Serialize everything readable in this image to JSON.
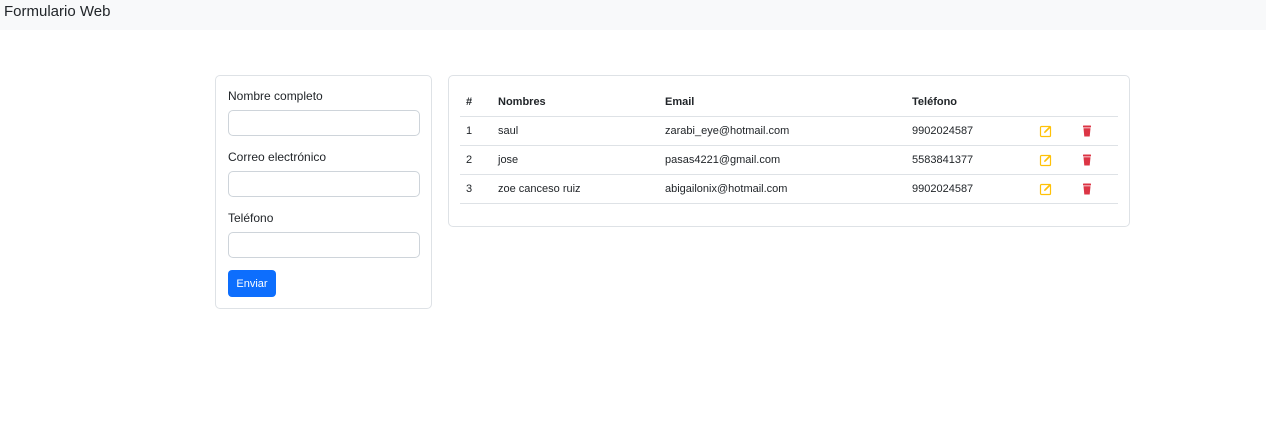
{
  "app": {
    "brand": "Formulario Web"
  },
  "form": {
    "fields": [
      {
        "label": "Nombre completo",
        "value": "",
        "placeholder": ""
      },
      {
        "label": "Correo electrónico",
        "value": "",
        "placeholder": ""
      },
      {
        "label": "Teléfono",
        "value": "",
        "placeholder": ""
      }
    ],
    "submit_label": "Enviar"
  },
  "table": {
    "headers": [
      "#",
      "Nombres",
      "Email",
      "Teléfono"
    ],
    "rows": [
      {
        "num": "1",
        "name": "saul",
        "email": "zarabi_eye@hotmail.com",
        "phone": "9902024587"
      },
      {
        "num": "2",
        "name": "jose",
        "email": "pasas4221@gmail.com",
        "phone": "5583841377"
      },
      {
        "num": "3",
        "name": "zoe canceso ruiz",
        "email": "abigailonix@hotmail.com",
        "phone": "9902024587"
      }
    ],
    "row_actions": [
      {
        "icon": "edit-icon",
        "color": "#ffc107"
      },
      {
        "icon": "trash-icon",
        "color": "#dc3545"
      }
    ]
  },
  "colors": {
    "primary": "#0d6efd",
    "warning": "#ffc107",
    "danger": "#dc3545",
    "navbar_bg": "#f8f9fa",
    "border": "#dee2e6"
  }
}
